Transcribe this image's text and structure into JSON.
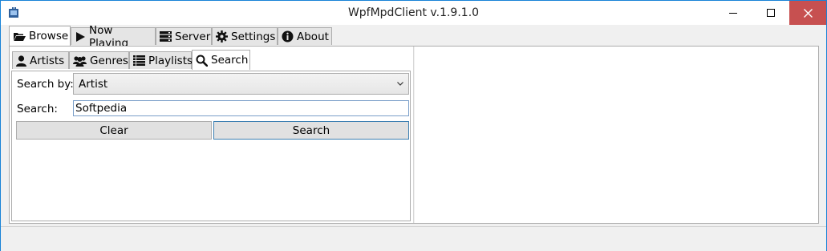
{
  "window": {
    "title": "WpfMpdClient v.1.9.1.0",
    "icons": {
      "app": "app-icon",
      "minimize": "minimize-icon",
      "maximize": "maximize-icon",
      "close": "close-icon"
    },
    "close_color": "#c75050"
  },
  "main_tabs": [
    {
      "label": "Browse",
      "icon": "folder-open-icon",
      "active": true
    },
    {
      "label": "Now Playing",
      "icon": "play-icon",
      "active": false
    },
    {
      "label": "Server",
      "icon": "server-icon",
      "active": false
    },
    {
      "label": "Settings",
      "icon": "gear-icon",
      "active": false
    },
    {
      "label": "About",
      "icon": "info-circle-icon",
      "active": false
    }
  ],
  "sub_tabs": [
    {
      "label": "Artists",
      "icon": "user-icon",
      "active": false
    },
    {
      "label": "Genres",
      "icon": "users-icon",
      "active": false
    },
    {
      "label": "Playlists",
      "icon": "list-icon",
      "active": false
    },
    {
      "label": "Search",
      "icon": "search-icon",
      "active": true
    }
  ],
  "search_form": {
    "search_by_label": "Search by:",
    "search_by_value": "Artist",
    "search_label": "Search:",
    "search_value": "Softpedia",
    "clear_button": "Clear",
    "search_button": "Search"
  }
}
